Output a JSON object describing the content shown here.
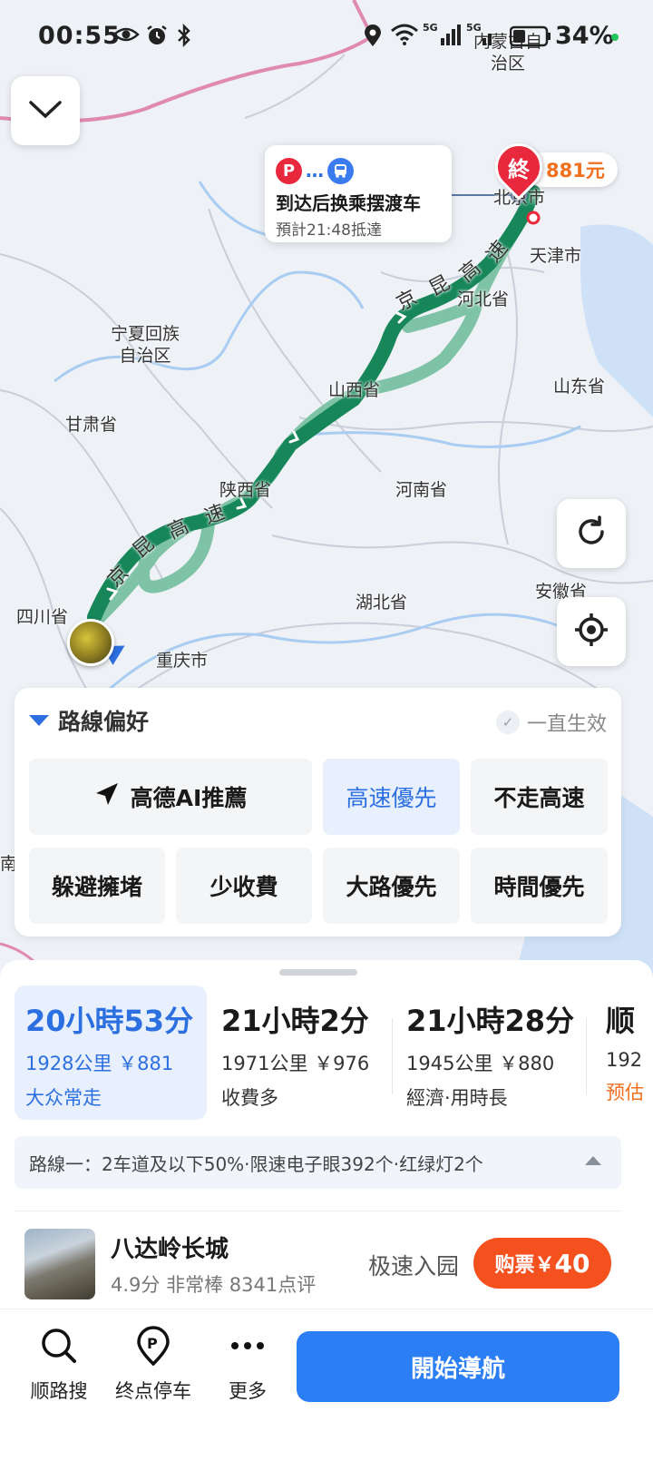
{
  "status_bar": {
    "time": "00:55",
    "battery": "34%",
    "icons": [
      "eye-icon",
      "alarm-icon",
      "bluetooth-icon",
      "location-icon",
      "wifi-icon",
      "signal-5g-icon",
      "signal-5g-icon",
      "battery-icon"
    ]
  },
  "map": {
    "region_labels": {
      "inner_mongolia": "内蒙古自\n治区",
      "beijing": "北京市",
      "tianjin": "天津市",
      "hebei": "河北省",
      "ningxia": "宁夏回族\n自治区",
      "shanxi": "山西省",
      "shandong": "山东省",
      "gansu": "甘肃省",
      "shaanxi": "陕西省",
      "henan": "河南省",
      "sichuan": "四川省",
      "hubei": "湖北省",
      "anhui": "安徽省",
      "chongqing": "重庆市",
      "edge_south": "南"
    },
    "road_labels": {
      "upper": [
        "京",
        "昆",
        "高",
        "速"
      ],
      "lower": [
        "京",
        "昆",
        "高",
        "速"
      ]
    },
    "callout": {
      "title": "到达后换乘摆渡车",
      "eta": "預計21:48抵達",
      "icons": [
        "parking-icon",
        "shuttle-bus-icon"
      ]
    },
    "destination": {
      "pin_text": "終",
      "price": "881元"
    }
  },
  "preferences": {
    "title": "路線偏好",
    "always_label": "一直生效",
    "options": {
      "ai": "高德AI推薦",
      "highway": "高速優先",
      "no_highway": "不走高速",
      "avoid_jam": "躲避擁堵",
      "less_toll": "少收費",
      "main_road": "大路優先",
      "time": "時間優先"
    },
    "selected": "highway"
  },
  "routes": [
    {
      "time": "20小時53分",
      "dist": "1928公里 ￥881",
      "tag": "大众常走",
      "selected": true
    },
    {
      "time": "21小時2分",
      "dist": "1971公里 ￥976",
      "tag": "收費多",
      "selected": false
    },
    {
      "time": "21小時28分",
      "dist": "1945公里 ￥880",
      "tag": "經濟·用時長",
      "selected": false
    },
    {
      "time": "顺",
      "dist": "192",
      "tag": "预估",
      "selected": false
    }
  ],
  "route_info": "路線一：2车道及以下50%·限速电子眼392个·红绿灯2个",
  "poi": {
    "name": "八达岭长城",
    "rating": "4.9分 非常棒 8341点评",
    "fast_entry": "极速入园",
    "ticket_label": "购票",
    "ticket_currency": "￥",
    "ticket_price": "40"
  },
  "actions": {
    "along_search": "顺路搜",
    "dest_parking": "终点停车",
    "more": "更多",
    "start_nav": "開始導航"
  },
  "colors": {
    "route_main": "#17875a",
    "route_alt": "#7fc3a6",
    "accent_blue": "#2c7ef5",
    "ticket_orange": "#f4511e",
    "price_orange": "#f07020"
  }
}
